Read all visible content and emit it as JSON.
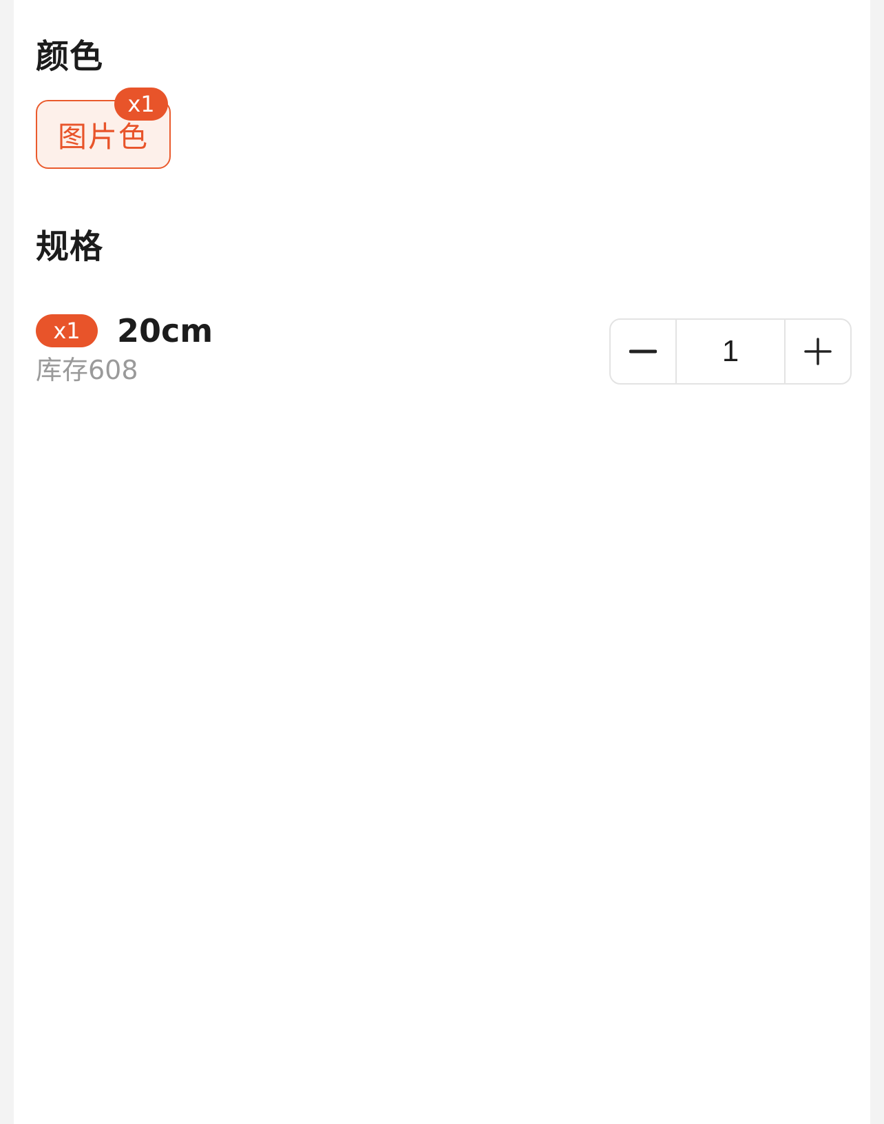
{
  "color_section": {
    "title": "颜色",
    "chips": [
      {
        "label": "图片色",
        "count_badge": "x1",
        "selected": true
      }
    ]
  },
  "spec_section": {
    "title": "规格",
    "items": [
      {
        "count_badge": "x1",
        "name": "20cm",
        "stock": "库存608",
        "quantity": "1"
      }
    ]
  },
  "icons": {
    "decrement": "minus-icon",
    "increment": "plus-icon"
  },
  "colors": {
    "accent": "#e8542a",
    "chip_background": "#fdf0ea",
    "text_primary": "#1c1c1c",
    "text_secondary": "#9a9a9a",
    "border": "#e3e3e3",
    "page_background": "#f3f3f3",
    "panel_background": "#ffffff"
  }
}
